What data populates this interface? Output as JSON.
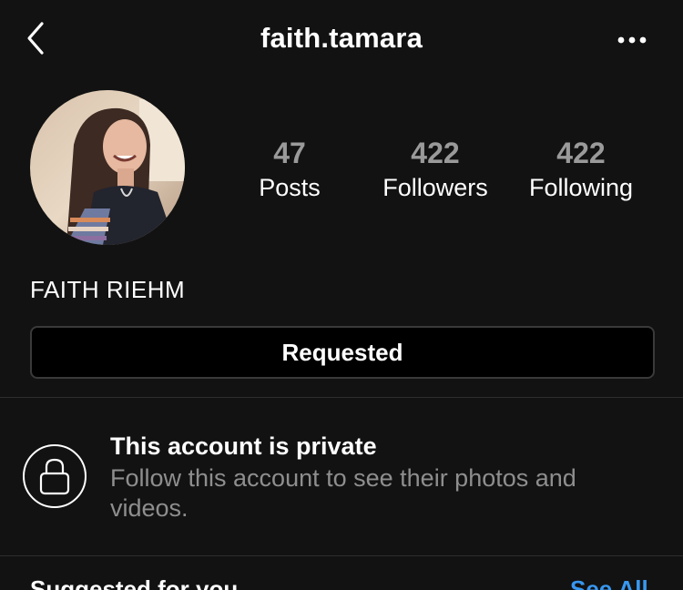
{
  "header": {
    "username": "faith.tamara",
    "back_icon": "chevron-left-icon",
    "more_icon": "more-horizontal-icon"
  },
  "profile": {
    "avatar_icon": "profile-photo",
    "display_name": "FAITH RIEHM",
    "stats": {
      "posts": {
        "value": "47",
        "label": "Posts"
      },
      "followers": {
        "value": "422",
        "label": "Followers"
      },
      "following": {
        "value": "422",
        "label": "Following"
      }
    },
    "action_button": "Requested"
  },
  "private_notice": {
    "icon": "lock-icon",
    "title": "This account is private",
    "description": "Follow this account to see their photos and videos."
  },
  "suggested": {
    "label": "Suggested for you",
    "see_all": "See All"
  },
  "colors": {
    "background": "#121212",
    "stat_number": "#9a9a9a",
    "muted_text": "#8e8e8e",
    "link": "#3897f0",
    "button_border": "#3a3a3a"
  }
}
